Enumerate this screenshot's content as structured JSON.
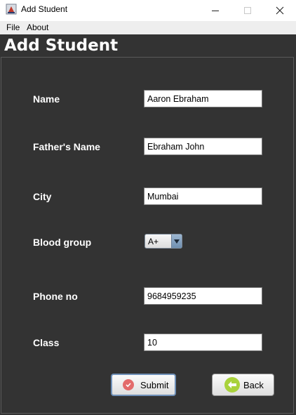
{
  "window": {
    "title": "Add Student",
    "minimize_glyph": "",
    "close_glyph": "✕"
  },
  "menu": {
    "items": [
      "File",
      "About"
    ]
  },
  "page": {
    "title": "Add Student"
  },
  "form": {
    "fields": [
      {
        "label": "Name",
        "value": "Aaron Ebraham"
      },
      {
        "label": "Father's Name",
        "value": "Ebraham John"
      },
      {
        "label": "City",
        "value": "Mumbai"
      },
      {
        "label": "Blood group",
        "value": "A+"
      },
      {
        "label": "Phone no",
        "value": "9684959235"
      },
      {
        "label": "Class",
        "value": "10"
      }
    ]
  },
  "buttons": {
    "submit": {
      "label": "Submit",
      "icon": "checkmark-circle-icon",
      "color": "#e36b6b"
    },
    "back": {
      "label": "Back",
      "icon": "arrow-left-circle-icon",
      "color": "#a9d23b"
    }
  },
  "colors": {
    "background": "#333333",
    "label_text": "#ffffff"
  }
}
